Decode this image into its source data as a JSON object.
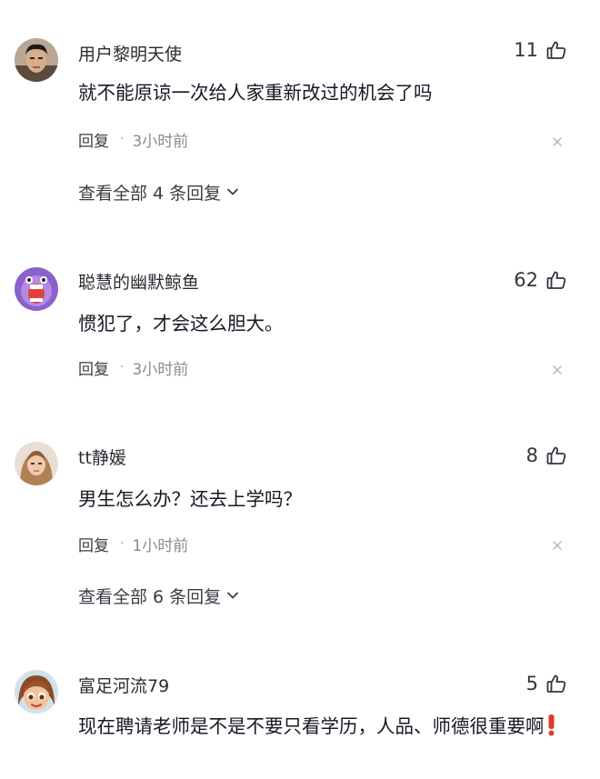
{
  "comments": [
    {
      "username": "用户黎明天使",
      "likes": "11",
      "text": "就不能原谅一次给人家重新改过的机会了吗",
      "reply_label": "回复",
      "separator": "·",
      "time": "3小时前",
      "view_replies": "查看全部 4 条回复"
    },
    {
      "username": "聪慧的幽默鲸鱼",
      "likes": "62",
      "text": "惯犯了，才会这么胆大。",
      "reply_label": "回复",
      "separator": "·",
      "time": "3小时前"
    },
    {
      "username": "tt静媛",
      "likes": "8",
      "text": "男生怎么办？还去上学吗？",
      "reply_label": "回复",
      "separator": "·",
      "time": "1小时前",
      "view_replies": "查看全部 6 条回复"
    },
    {
      "username": "富足河流79",
      "likes": "5",
      "text": "现在聘请老师是不是不要只看学历，人品、师德很重要啊",
      "emoji_icon": "red-exclamation-icon"
    }
  ],
  "icons": {
    "like": "thumbs-up-icon",
    "dismiss": "close-icon",
    "expand": "chevron-down-icon"
  },
  "colors": {
    "text_primary": "#161823",
    "text_secondary": "#8a8b93",
    "exclaim_red": "#e23a2e"
  }
}
